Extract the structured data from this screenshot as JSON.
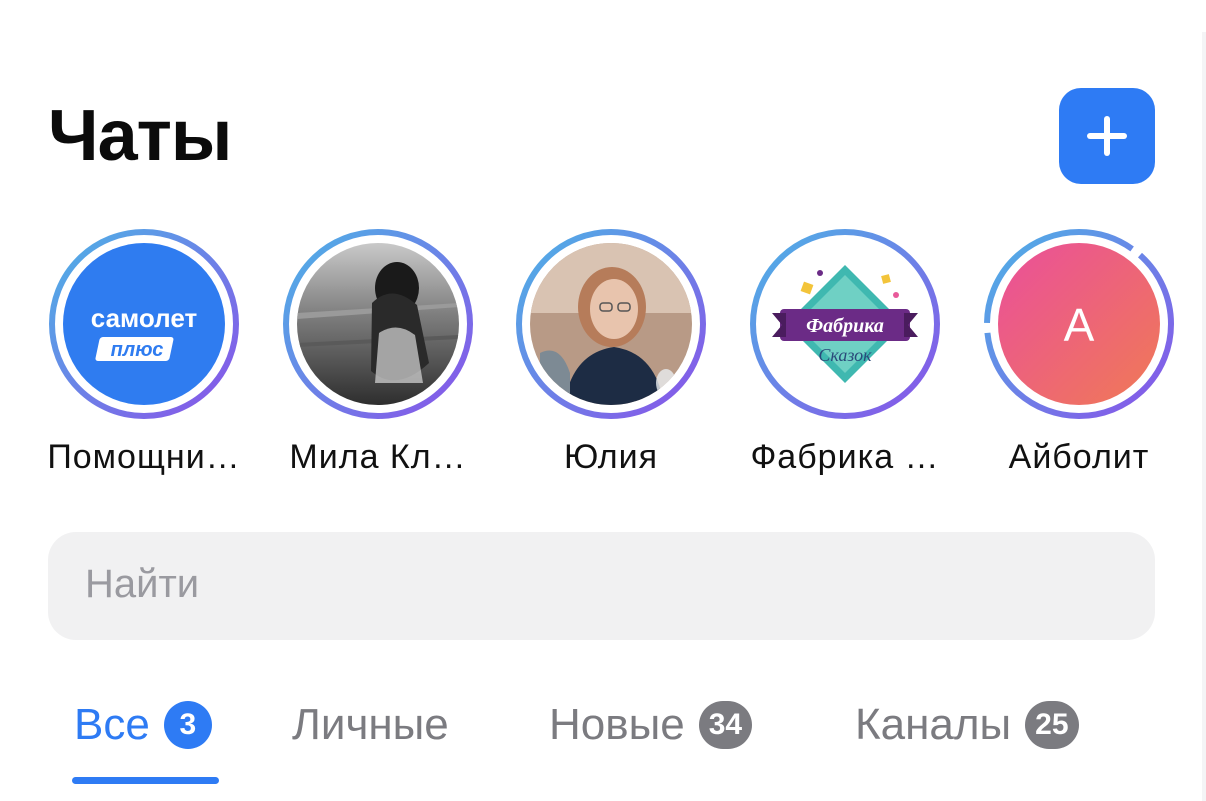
{
  "header": {
    "title": "Чаты",
    "add_icon": "plus-icon"
  },
  "stories": [
    {
      "label": "Помощни…",
      "avatar_text_1": "самолет",
      "avatar_text_2": "плюс"
    },
    {
      "label": "Мила Кл…"
    },
    {
      "label": "Юлия"
    },
    {
      "label": "Фабрика …",
      "avatar_text_1": "Фабрика",
      "avatar_text_2": "Сказок"
    },
    {
      "label": "Айболит",
      "avatar_letter": "А"
    }
  ],
  "search": {
    "placeholder": "Найти"
  },
  "tabs": [
    {
      "label": "Все",
      "badge": "3",
      "active": true
    },
    {
      "label": "Личные"
    },
    {
      "label": "Новые",
      "badge": "34"
    },
    {
      "label": "Каналы",
      "badge": "25"
    }
  ],
  "colors": {
    "accent": "#2e7bf4",
    "badge_gray": "#7b7b80",
    "search_bg": "#f1f1f2",
    "ring_gradient": [
      "#4db3e6",
      "#8a52e8"
    ]
  }
}
